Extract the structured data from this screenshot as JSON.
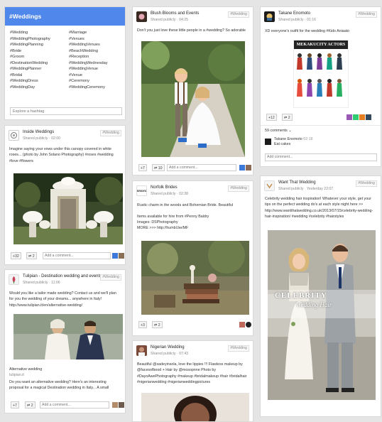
{
  "hashtag_card": {
    "header": "#Weddings",
    "col1": [
      "#Wedding",
      "#WeddingPhotography",
      "#WeddingPlanning",
      "#Bride",
      "#Groom",
      "#DestinationWedding",
      "#WeddingPlanner",
      "#Bridal",
      "#WeddingDress",
      "#WeddingDay"
    ],
    "col2": [
      "#Marriage",
      "#Venues",
      "#WeddingVenues",
      "#BeachWedding",
      "#Reception",
      "#WeddingWednesday",
      "#WeddingVenue",
      "#Venue",
      "#Ceremony",
      "#WeddingCeremony"
    ],
    "explore_placeholder": "Explore a hashtag"
  },
  "posts": {
    "inside": {
      "author": "Inside Weddings",
      "meta": "Shared publicly  ·  02:00",
      "tag": "#Wedding",
      "text": "Imagine saying your vows under this canopy covered in white roses... (photo by John Solano Photography) #roses #wedding #love #flowers",
      "plus": "+32",
      "shares": "2",
      "comment_placeholder": "Add a comment..."
    },
    "tulip": {
      "author": "Tulipian - Destination wedding and events",
      "meta": "Shared publicly  ·  11:06",
      "tag": "#Wedding",
      "text": "Would you like a tailor made wedding? Contact us and we'll plan for you the wedding of your dreams... anywhere in Italy! http://www.tulipian.it/en/alternative-wedding/",
      "text2": "Alternative wedding",
      "text3": "tulipian.it",
      "text4": "Do you want an alternative wedding? Here's an interesting proposal for a magical Destination wedding in Italy... A small",
      "plus": "+7",
      "shares": "2",
      "comment_placeholder": "Add a comment..."
    },
    "blush": {
      "author": "Blush Blooms and Events",
      "meta": "Shared publicly  ·  04:25",
      "tag": "#Wedding",
      "text": "Don't you just love these little people in a #wedding? So adorable",
      "plus": "+7",
      "shares": "10",
      "comment_placeholder": "Add a comment..."
    },
    "norfolk": {
      "author": "Norfolk Brides",
      "meta": "Shared publicly  ·  02:38",
      "tag": "#Wedding",
      "avatar_label": "BRIDES",
      "text": "Rustic charm in the woods and Bohemian Bride. Beautiful",
      "text2": "Items available for hire from #Penny Baldry",
      "text3": "Images: DSPhotography",
      "text4": "MORE >>> http://humbl.be/MF",
      "plus": "+3",
      "shares": "2"
    },
    "nigerian": {
      "author": "Nigerian Wedding",
      "meta": "Shared publicly  ·  07:43",
      "tag": "#Wedding",
      "text": "Beautiful @sadeyinsola, love the lippies !!! Flawless makeup by @facesofbood + Hair by @mosopnne Photo by #DayoAwePhotography #makeup #bridalmakeup #hair #bridalhair #nigerianwedding #nigerianweddingpictures"
    },
    "takane": {
      "author": "Takane Enomoto",
      "meta": "Shared publicly  ·  01:16",
      "tag": "#Wedding",
      "text": "XD everyone's outfit for the wedding #Kido Aniaato",
      "image_title": "MEKAKUCITY ACTORS",
      "plus": "+12",
      "shares": "2",
      "comments_count": "59 comments",
      "commenter": "Takane Enomoto",
      "comment_time": "02:18",
      "comment_text": "Eat cakes",
      "comment_placeholder": "Add comment..."
    },
    "want": {
      "author": "Want That Wedding",
      "meta": "Shared publicly  ·  Yesterday 22:07",
      "tag": "#Wedding",
      "text": "Celebrity wedding hair inspiration! Whatever your style, get your tips on the perfect wedding do's at each style night here >> http://www.wantthatwedding.co.uk/2013/07/15/celebrity-wedding-hair-inspiration/ #wedding #celebrity #hairstyles",
      "overlay1": "CELEBRITY",
      "overlay2": "Wedding Hair"
    }
  },
  "colors": {
    "header_blue": "#4f87ea",
    "background": "#e5e5e5"
  }
}
